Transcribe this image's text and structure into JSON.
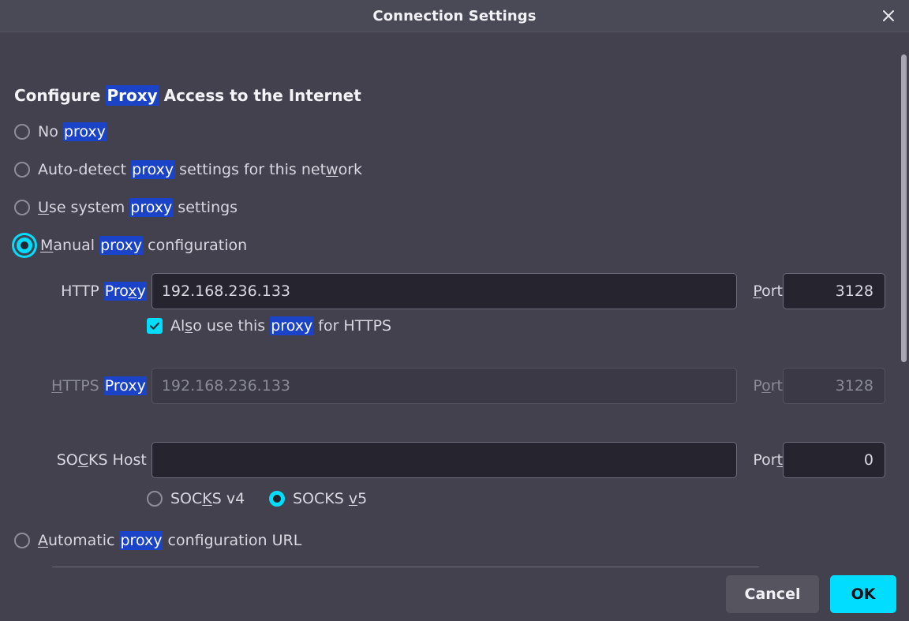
{
  "window": {
    "title": "Connection Settings",
    "close_icon": "close-icon"
  },
  "section": {
    "heading_part1": "Configure ",
    "heading_highlight": "Proxy",
    "heading_part2": " Access to the Internet"
  },
  "proxy_mode": {
    "selected": "manual",
    "options": [
      {
        "id": "no-proxy",
        "pre": "No ",
        "highlight": "proxy",
        "post": "",
        "checked": false
      },
      {
        "id": "auto-detect",
        "pre": "Auto-detect ",
        "highlight": "proxy",
        "post": " settings for this network",
        "checked": false
      },
      {
        "id": "use-system",
        "pre": "Use system ",
        "highlight": "proxy",
        "post": " settings",
        "checked": false
      },
      {
        "id": "manual",
        "pre": "Manual ",
        "highlight": "proxy",
        "post": " configuration",
        "checked": true
      },
      {
        "id": "auto-url",
        "pre": "Automatic ",
        "highlight": "proxy",
        "post": " configuration URL",
        "checked": false
      }
    ]
  },
  "http_proxy": {
    "label_pre": "HTTP ",
    "label_highlight": "Proxy",
    "value": "192.168.236.133",
    "port_label": "Port",
    "port_value": "3128",
    "disabled": false
  },
  "https_checkbox": {
    "pre": "Also use this ",
    "highlight": "proxy",
    "post": " for HTTPS",
    "checked": true
  },
  "https_proxy": {
    "label_pre": "HTTPS ",
    "label_highlight": "Proxy",
    "value": "192.168.236.133",
    "port_label": "Port",
    "port_value": "3128",
    "disabled": true
  },
  "socks_host": {
    "label": "SOCKS Host",
    "value": "",
    "port_label": "Port",
    "port_value": "0"
  },
  "socks_version": {
    "selected": "v5",
    "options": [
      {
        "id": "v4",
        "label": "SOCKS v4",
        "checked": false
      },
      {
        "id": "v5",
        "label": "SOCKS v5",
        "checked": true
      }
    ]
  },
  "pac_url": {
    "value": ""
  },
  "footer": {
    "cancel_label": "Cancel",
    "ok_label": "OK"
  },
  "colors": {
    "accent": "#00ddff",
    "find_highlight": "#1a43c8",
    "dialog_bg": "#42414d",
    "input_bg": "#26242f"
  }
}
